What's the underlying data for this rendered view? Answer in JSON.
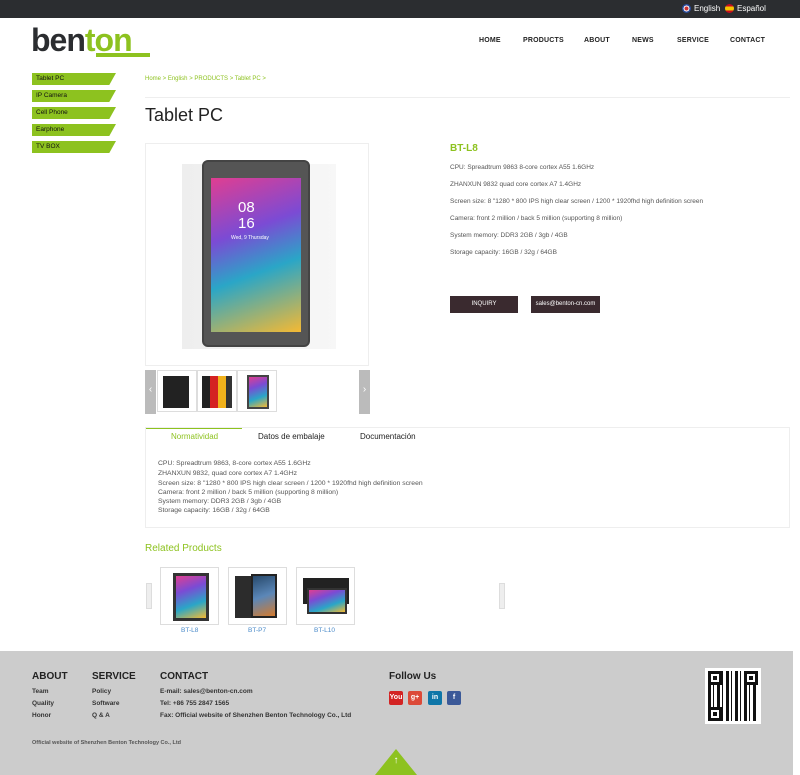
{
  "topbar": {
    "lang_en": "English",
    "lang_es": "Español"
  },
  "brand": {
    "logo_dark": "ben",
    "logo_green": "ton"
  },
  "nav": [
    "HOME",
    "PRODUCTS",
    "ABOUT",
    "NEWS",
    "SERVICE",
    "CONTACT"
  ],
  "sidebar": [
    "Tablet PC",
    "IP Camera",
    "Cell Phone",
    "Earphone",
    "TV BOX"
  ],
  "breadcrumb": "Home > English > PRODUCTS > Tablet PC >",
  "page_title": "Tablet PC",
  "product": {
    "name": "BT-L8",
    "screen_time": "08\n16",
    "screen_date": "Wed, 9 Thursday",
    "specs": [
      "CPU: Spreadtrum 9863 8-core cortex A55 1.6GHz",
      "ZHANXUN 9832 quad core cortex A7 1.4GHz",
      "Screen size: 8 \"1280 * 800 IPS high clear screen / 1200 * 1920fhd high definition screen",
      "Camera: front 2 million / back 5 million (supporting 8 million)",
      "System memory: DDR3 2GB / 3gb / 4GB",
      "Storage capacity: 16GB / 32g / 64GB"
    ],
    "inquiry_label": "INQUIRY",
    "email_label": "sales@benton-cn.com"
  },
  "tabs": [
    "Normatividad",
    "Datos de embalaje",
    "Documentación"
  ],
  "description": [
    "CPU: Spreadtrum 9863, 8-core cortex A55 1.6GHz",
    "ZHANXUN 9832, quad core cortex A7 1.4GHz",
    "Screen size: 8 \"1280 * 800 IPS high clear screen / 1200 * 1920fhd high definition screen",
    "Camera: front 2 million / back 5 million (supporting 8 million)",
    "System memory: DDR3 2GB / 3gb / 4GB",
    "Storage capacity: 16GB / 32g / 64GB"
  ],
  "related": {
    "title": "Related Products",
    "items": [
      "BT-L8",
      "BT-P7",
      "BT-L10"
    ]
  },
  "footer": {
    "about": {
      "title": "ABOUT",
      "links": [
        "Team",
        "Quality",
        "Honor"
      ]
    },
    "service": {
      "title": "SERVICE",
      "links": [
        "Policy",
        "Software",
        "Q & A"
      ]
    },
    "contact": {
      "title": "CONTACT",
      "email": "E-mail: sales@benton-cn.com",
      "tel": "Tel: +86 755 2847 1565",
      "fax": "Fax:  Official website of Shenzhen Benton Technology Co., Ltd"
    },
    "follow_title": "Follow Us",
    "social": [
      "You",
      "g+",
      "in",
      "f"
    ],
    "copyright": "Official website of Shenzhen Benton Technology Co., Ltd"
  },
  "colors": {
    "accent": "#8dc21f",
    "dark": "#2b2d30",
    "button": "#3a2a2f",
    "footer": "#cccccc"
  }
}
